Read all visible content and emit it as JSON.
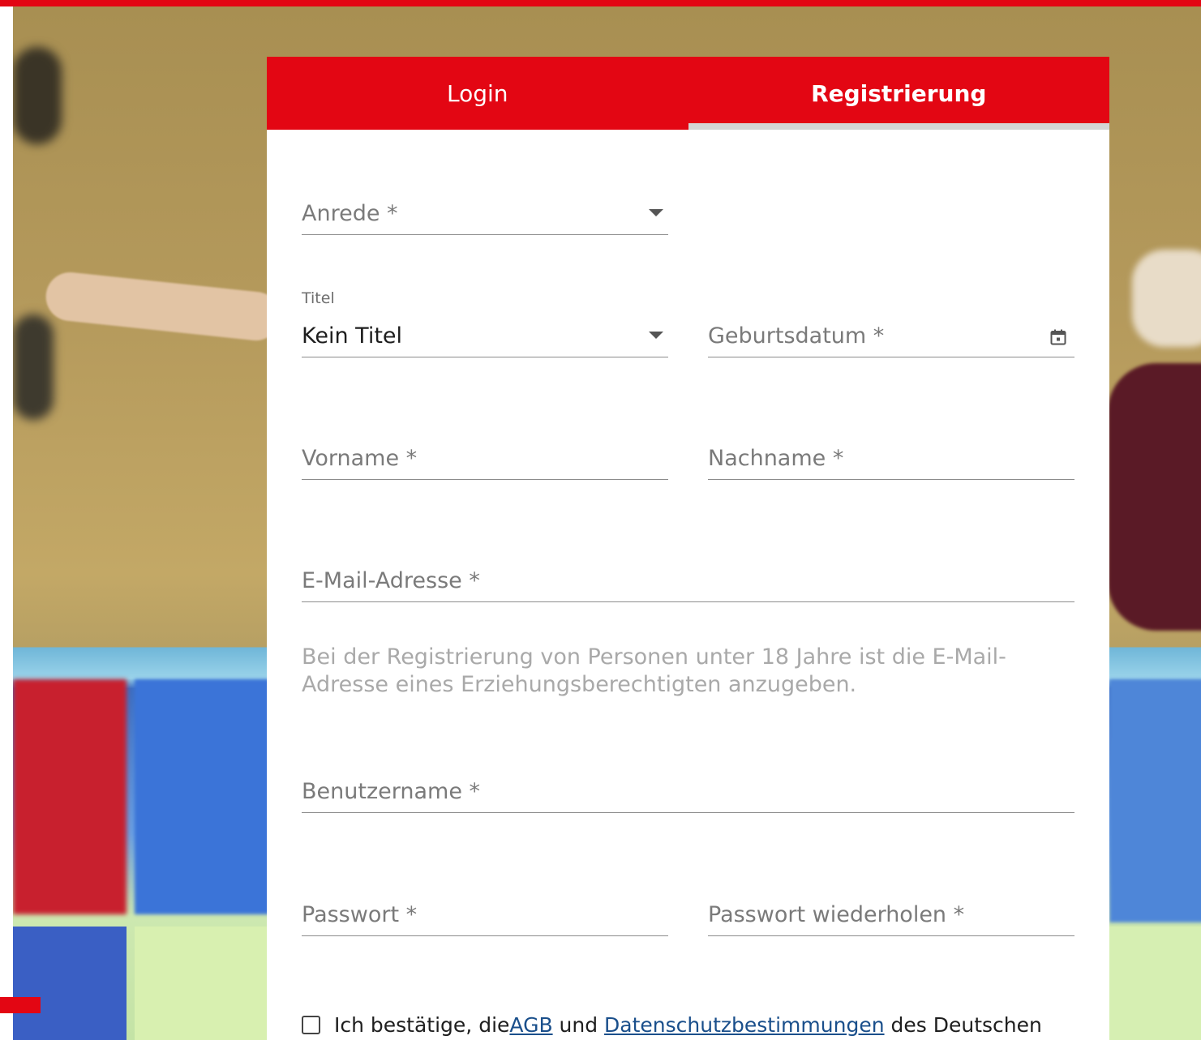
{
  "tabs": {
    "login": "Login",
    "register": "Registrierung"
  },
  "form": {
    "anrede_placeholder": "Anrede *",
    "titel_label": "Titel",
    "titel_value": "Kein Titel",
    "geburtsdatum_placeholder": "Geburtsdatum *",
    "vorname_placeholder": "Vorname *",
    "nachname_placeholder": "Nachname *",
    "email_placeholder": "E-Mail-Adresse *",
    "email_hint": "Bei der Registrierung von Personen unter 18 Jahre ist die E-Mail-Adresse eines Erziehungsberechtigten anzugeben.",
    "benutzername_placeholder": "Benutzername *",
    "passwort_placeholder": "Passwort *",
    "passwort_repeat_placeholder": "Passwort wiederholen *"
  },
  "consent": {
    "text_before": "Ich bestätige, die ",
    "agb_link": "AGB",
    "text_middle": " und ",
    "privacy_link": "Datenschutzbestimmungen",
    "text_after": " des Deutschen"
  },
  "colors": {
    "brand_red": "#e30613",
    "link_blue": "#1a4f8b",
    "tab_indicator": "#d4d4d4"
  },
  "icons": {
    "dropdown": "caret-down-icon",
    "date": "calendar-icon"
  }
}
